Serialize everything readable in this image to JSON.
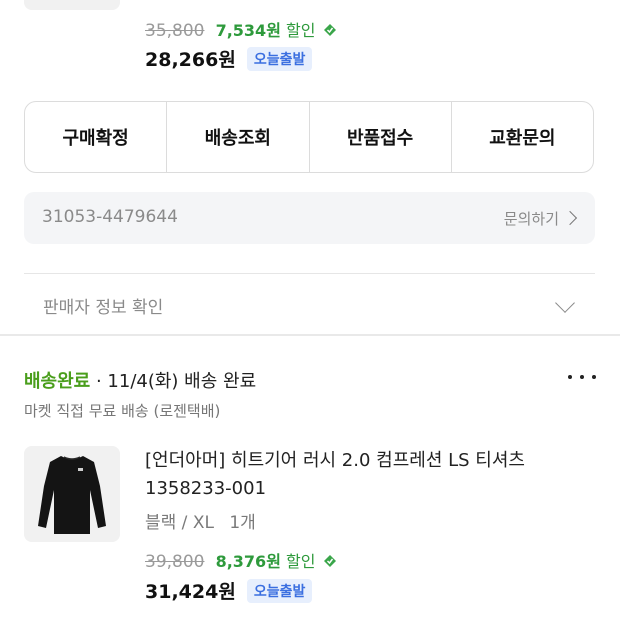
{
  "order1": {
    "original_price": "35,800",
    "discount_amount": "7,534원",
    "discount_word": "할인",
    "final_price": "28,266원",
    "badge": "오늘출발"
  },
  "actions": [
    "구매확정",
    "배송조회",
    "반품접수",
    "교환문의"
  ],
  "inquiry": {
    "order_number": "31053-4479644",
    "link_label": "문의하기"
  },
  "seller_info_label": "판매자 정보 확인",
  "order2": {
    "status_label": "배송완료",
    "status_detail": " · 11/4(화) 배송 완료",
    "shipping_note": "마켓 직접 무료 배송 (로젠택배)",
    "product_name": "[언더아머] 히트기어 러시 2.0 컴프레션 LS 티셔츠 1358233-001",
    "option": "블랙 / XL",
    "quantity": "1개",
    "original_price": "39,800",
    "discount_amount": "8,376원",
    "discount_word": "할인",
    "final_price": "31,424원",
    "badge": "오늘출발"
  },
  "colors": {
    "discount_green": "#2e9a3c",
    "status_green": "#4a9e1c",
    "badge_blue": "#3b6fe0",
    "badge_bg": "#e7effd"
  }
}
